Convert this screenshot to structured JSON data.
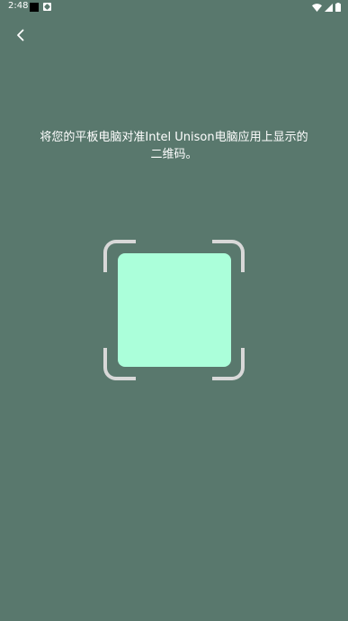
{
  "status_bar": {
    "time": "2:48",
    "icons": [
      "notification-square-icon",
      "app-notification-icon",
      "wifi-icon",
      "cell-signal-icon",
      "battery-icon"
    ]
  },
  "navigation": {
    "back_icon": "chevron-left-icon"
  },
  "instruction": {
    "text": "将您的平板电脑对准Intel Unison电脑应用上显示的二维码。"
  },
  "colors": {
    "background": "#59786d",
    "qr_placeholder": "#abffda",
    "frame_corners": "#d8d8d8",
    "text": "#ffffff"
  }
}
